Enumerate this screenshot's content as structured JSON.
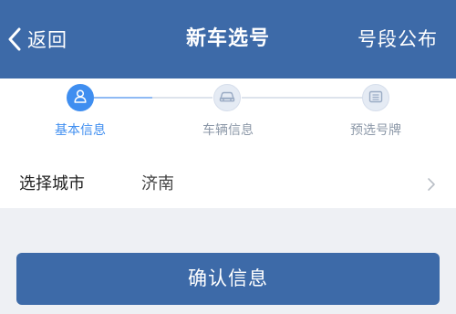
{
  "header": {
    "back_label": "返回",
    "title": "新车选号",
    "announce_label": "号段公布"
  },
  "steps": [
    {
      "label": "基本信息",
      "icon": "user-icon",
      "state": "active"
    },
    {
      "label": "车辆信息",
      "icon": "car-icon",
      "state": "inactive"
    },
    {
      "label": "预选号牌",
      "icon": "license-plate-icon",
      "state": "inactive"
    }
  ],
  "city": {
    "label": "选择城市",
    "value": "济南"
  },
  "confirm_label": "确认信息",
  "colors": {
    "brand": "#3d6aa8",
    "active_step": "#3f8ef0",
    "inactive_step_bg": "#e5ebf4",
    "page_bg": "#eef0f4"
  }
}
